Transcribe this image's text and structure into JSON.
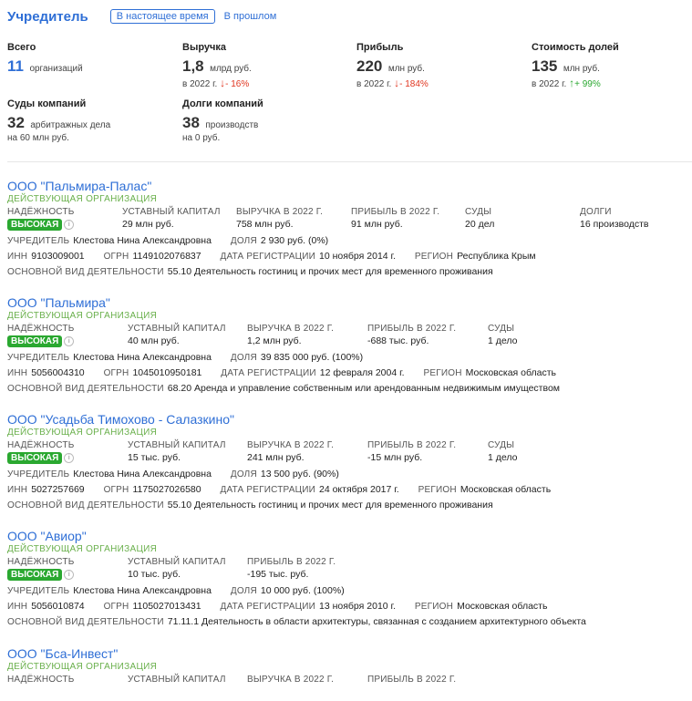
{
  "header": {
    "title": "Учредитель",
    "tab_current": "В настоящее время",
    "tab_past": "В прошлом"
  },
  "stats": {
    "total": {
      "label": "Всего",
      "value": "11",
      "unit": "организаций"
    },
    "revenue": {
      "label": "Выручка",
      "value": "1,8",
      "unit": "млрд руб.",
      "year": "в 2022 г.",
      "delta": "- 16%"
    },
    "profit": {
      "label": "Прибыль",
      "value": "220",
      "unit": "млн руб.",
      "year": "в 2022 г.",
      "delta": "- 184%"
    },
    "shares": {
      "label": "Стоимость долей",
      "value": "135",
      "unit": "млн руб.",
      "year": "в 2022 г.",
      "delta": "+ 99%"
    },
    "courts": {
      "label": "Суды компаний",
      "value": "32",
      "unit": "арбитражных дела",
      "sub": "на 60 млн руб."
    },
    "debts": {
      "label": "Долги компаний",
      "value": "38",
      "unit": "производств",
      "sub": "на 0 руб."
    }
  },
  "labels": {
    "reliability": "НАДЁЖНОСТЬ",
    "capital": "УСТАВНЫЙ КАПИТАЛ",
    "revenue": "ВЫРУЧКА В 2022 Г.",
    "profit": "ПРИБЫЛЬ В 2022 Г.",
    "courts": "СУДЫ",
    "debts": "ДОЛГИ",
    "founder": "УЧРЕДИТЕЛЬ",
    "share": "ДОЛЯ",
    "inn": "ИНН",
    "ogrn": "ОГРН",
    "reg_date": "ДАТА РЕГИСТРАЦИИ",
    "region": "РЕГИОН",
    "activity": "ОСНОВНОЙ ВИД ДЕЯТЕЛЬНОСТИ"
  },
  "companies": [
    {
      "name": "ООО \"Пальмира-Палас\"",
      "status": "ДЕЙСТВУЮЩАЯ ОРГАНИЗАЦИЯ",
      "reliability": "ВЫСОКАЯ",
      "capital": "29 млн руб.",
      "revenue": "758 млн руб.",
      "profit": "91 млн руб.",
      "courts": "20 дел",
      "debts": "16 производств",
      "founder": "Клестова Нина Александровна",
      "share": "2 930 руб. (0%)",
      "inn": "9103009001",
      "ogrn": "1149102076837",
      "reg_date": "10 ноября 2014 г.",
      "region": "Республика Крым",
      "activity": "55.10 Деятельность гостиниц и прочих мест для временного проживания"
    },
    {
      "name": "ООО \"Пальмира\"",
      "status": "ДЕЙСТВУЮЩАЯ ОРГАНИЗАЦИЯ",
      "reliability": "ВЫСОКАЯ",
      "capital": "40 млн руб.",
      "revenue": "1,2 млн руб.",
      "profit": "-688 тыс. руб.",
      "courts": "1 дело",
      "founder": "Клестова Нина Александровна",
      "share": "39 835 000 руб. (100%)",
      "inn": "5056004310",
      "ogrn": "1045010950181",
      "reg_date": "12 февраля 2004 г.",
      "region": "Московская область",
      "activity": "68.20 Аренда и управление собственным или арендованным недвижимым имуществом"
    },
    {
      "name": "ООО \"Усадьба Тимохово - Салазкино\"",
      "status": "ДЕЙСТВУЮЩАЯ ОРГАНИЗАЦИЯ",
      "reliability": "ВЫСОКАЯ",
      "capital": "15 тыс. руб.",
      "revenue": "241 млн руб.",
      "profit": "-15 млн руб.",
      "courts": "1 дело",
      "founder": "Клестова Нина Александровна",
      "share": "13 500 руб. (90%)",
      "inn": "5027257669",
      "ogrn": "1175027026580",
      "reg_date": "24 октября 2017 г.",
      "region": "Московская область",
      "activity": "55.10 Деятельность гостиниц и прочих мест для временного проживания"
    },
    {
      "name": "ООО \"Авиор\"",
      "status": "ДЕЙСТВУЮЩАЯ ОРГАНИЗАЦИЯ",
      "reliability": "ВЫСОКАЯ",
      "capital": "10 тыс. руб.",
      "profit": "-195 тыс. руб.",
      "founder": "Клестова Нина Александровна",
      "share": "10 000 руб. (100%)",
      "inn": "5056010874",
      "ogrn": "1105027013431",
      "reg_date": "13 ноября 2010 г.",
      "region": "Московская область",
      "activity": "71.11.1 Деятельность в области архитектуры, связанная с созданием архитектурного объекта"
    },
    {
      "name": "ООО \"Бса-Инвест\"",
      "status": "ДЕЙСТВУЮЩАЯ ОРГАНИЗАЦИЯ"
    }
  ]
}
